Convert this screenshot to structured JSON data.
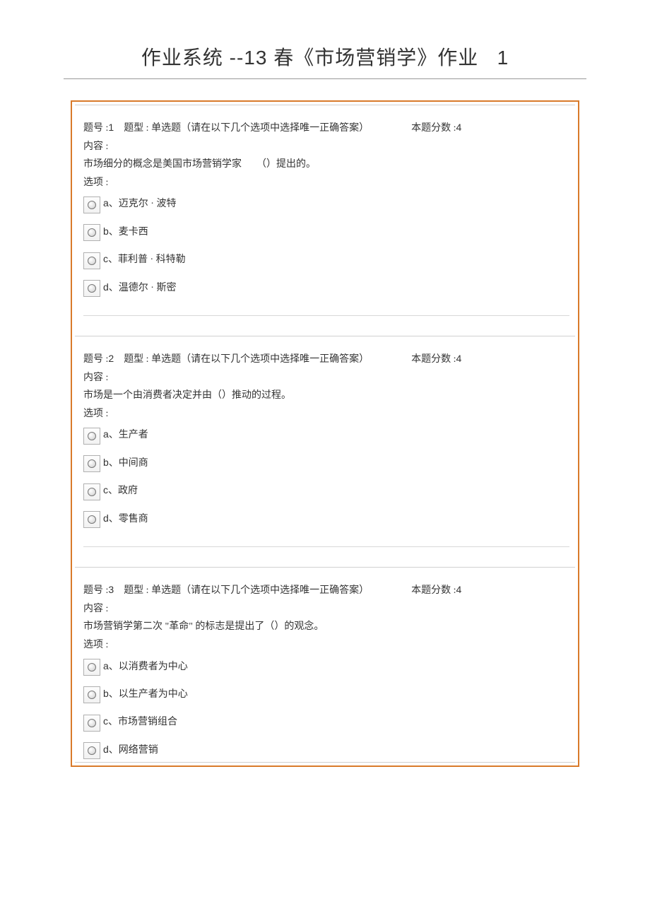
{
  "title_prefix": "作业系统 --",
  "title_num": "13",
  "title_mid": " 春《市场营销学》作业",
  "title_suffix": "1",
  "labels": {
    "qno_prefix": "题号 :",
    "qtype_prefix": "题型 : ",
    "qtype_text": "单选题（请在以下几个选项中选择唯一正确答案）",
    "score_prefix": "本题分数 :",
    "content": "内容 :",
    "options": "选项 :"
  },
  "questions": [
    {
      "no": "1",
      "score": "4",
      "stem_pre": "市场细分的概念是美国市场营销学家",
      "stem_post": "（）提出的。",
      "options": [
        {
          "key": "a",
          "text": "、迈克尔 · 波特"
        },
        {
          "key": "b",
          "text": "、麦卡西"
        },
        {
          "key": "c",
          "text": "、菲利普 · 科特勒"
        },
        {
          "key": "d",
          "text": "、温德尔 · 斯密"
        }
      ]
    },
    {
      "no": "2",
      "score": "4",
      "stem_full": "市场是一个由消费者决定并由（）推动的过程。",
      "options": [
        {
          "key": "a",
          "text": "、生产者"
        },
        {
          "key": "b",
          "text": "、中间商"
        },
        {
          "key": "c",
          "text": "、政府"
        },
        {
          "key": "d",
          "text": "、零售商"
        }
      ]
    },
    {
      "no": "3",
      "score": "4",
      "stem_full": "市场营销学第二次 \"革命\" 的标志是提出了（）的观念。",
      "options": [
        {
          "key": "a",
          "text": "、以消费者为中心"
        },
        {
          "key": "b",
          "text": "、以生产者为中心"
        },
        {
          "key": "c",
          "text": "、市场营销组合"
        },
        {
          "key": "d",
          "text": "、网络营销"
        }
      ]
    }
  ]
}
